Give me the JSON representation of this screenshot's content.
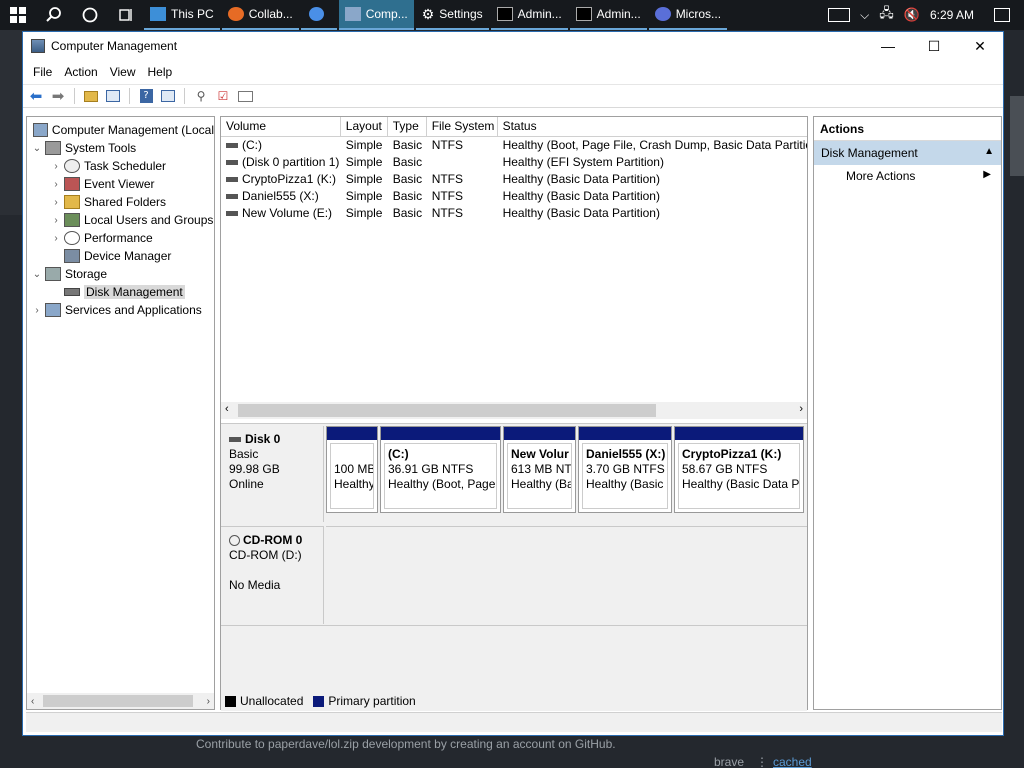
{
  "taskbar": {
    "apps": [
      {
        "label": "This PC",
        "active": false
      },
      {
        "label": "Collab...",
        "active": false
      },
      {
        "label": "",
        "active": false
      },
      {
        "label": "Comp...",
        "active": true
      },
      {
        "label": "Settings",
        "active": false
      },
      {
        "label": "Admin...",
        "active": false
      },
      {
        "label": "Admin...",
        "active": false
      },
      {
        "label": "Micros...",
        "active": false
      }
    ],
    "clock": "6:29 AM"
  },
  "window": {
    "title": "Computer Management",
    "menu": [
      "File",
      "Action",
      "View",
      "Help"
    ]
  },
  "tree": [
    {
      "label": "Computer Management (Local",
      "level": 0,
      "exp": "",
      "icon": "computer-icon"
    },
    {
      "label": "System Tools",
      "level": 1,
      "exp": "⌄",
      "icon": "tools-icon"
    },
    {
      "label": "Task Scheduler",
      "level": 2,
      "exp": "›",
      "icon": "clock-icon"
    },
    {
      "label": "Event Viewer",
      "level": 2,
      "exp": "›",
      "icon": "event-viewer-icon"
    },
    {
      "label": "Shared Folders",
      "level": 2,
      "exp": "›",
      "icon": "shared-folder-icon"
    },
    {
      "label": "Local Users and Groups",
      "level": 2,
      "exp": "›",
      "icon": "users-icon"
    },
    {
      "label": "Performance",
      "level": 2,
      "exp": "›",
      "icon": "performance-icon"
    },
    {
      "label": "Device Manager",
      "level": 2,
      "exp": "",
      "icon": "device-manager-icon"
    },
    {
      "label": "Storage",
      "level": 1,
      "exp": "⌄",
      "icon": "storage-icon"
    },
    {
      "label": "Disk Management",
      "level": 2,
      "exp": "",
      "icon": "disk-icon",
      "selected": true
    },
    {
      "label": "Services and Applications",
      "level": 1,
      "exp": "›",
      "icon": "services-icon"
    }
  ],
  "volumes": {
    "headers": [
      "Volume",
      "Layout",
      "Type",
      "File System",
      "Status"
    ],
    "rows": [
      [
        "(C:)",
        "Simple",
        "Basic",
        "NTFS",
        "Healthy (Boot, Page File, Crash Dump, Basic Data Partitio"
      ],
      [
        "(Disk 0 partition 1)",
        "Simple",
        "Basic",
        "",
        "Healthy (EFI System Partition)"
      ],
      [
        "CryptoPizza1 (K:)",
        "Simple",
        "Basic",
        "NTFS",
        "Healthy (Basic Data Partition)"
      ],
      [
        "Daniel555 (X:)",
        "Simple",
        "Basic",
        "NTFS",
        "Healthy (Basic Data Partition)"
      ],
      [
        "New Volume (E:)",
        "Simple",
        "Basic",
        "NTFS",
        "Healthy (Basic Data Partition)"
      ]
    ]
  },
  "disk0": {
    "name": "Disk 0",
    "type": "Basic",
    "size": "99.98 GB",
    "state": "Online",
    "partitions": [
      {
        "title": "",
        "line1": "100 MB",
        "line2": "Healthy"
      },
      {
        "title": "(C:)",
        "line1": "36.91 GB NTFS",
        "line2": "Healthy (Boot, Page"
      },
      {
        "title": "New Volur",
        "line1": "613 MB NTI",
        "line2": "Healthy (Ba"
      },
      {
        "title": "Daniel555  (X:)",
        "line1": "3.70 GB NTFS",
        "line2": "Healthy (Basic I"
      },
      {
        "title": "CryptoPizza1  (K:)",
        "line1": "58.67 GB NTFS",
        "line2": "Healthy (Basic Data Pa"
      }
    ]
  },
  "cdrom": {
    "name": "CD-ROM 0",
    "drive": "CD-ROM (D:)",
    "media": "No Media"
  },
  "legend": {
    "unallocated": "Unallocated",
    "primary": "Primary partition"
  },
  "actions": {
    "header": "Actions",
    "section": "Disk Management",
    "item": "More Actions"
  },
  "background": {
    "footer": "Contribute to paperdave/lol.zip development by creating an account on GitHub.",
    "brave": "brave",
    "dots": "⋮",
    "cached": "cached"
  }
}
